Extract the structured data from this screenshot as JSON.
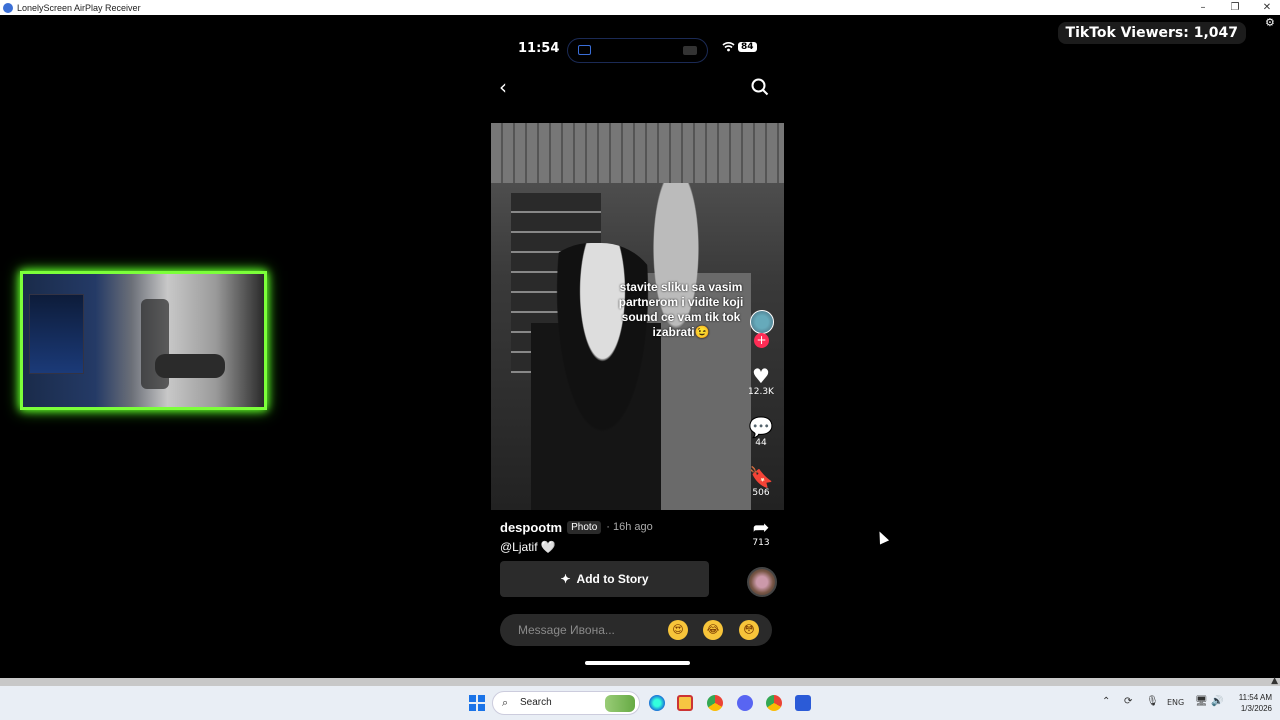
{
  "window": {
    "title": "LonelyScreen AirPlay Receiver",
    "minimize": "–",
    "restore": "❐",
    "close": "✕"
  },
  "overlay": {
    "viewers": "TikTok Viewers: 1,047"
  },
  "phone": {
    "time": "11:54",
    "battery": "84",
    "post": {
      "caption": "stavite sliku sa vasim partnerom i vidite koji sound ce vam tik tok izabrati😉",
      "likes": "12.3K",
      "comments": "44",
      "saves": "506",
      "shares": "713",
      "username": "despootm",
      "type_badge": "Photo",
      "age": "· 16h ago",
      "mention": "@Ljatif 🤍",
      "add_to_story": "Add to Story"
    },
    "message": {
      "placeholder": "Message Ивона...",
      "emojis": [
        "😍",
        "😂",
        "😳"
      ]
    }
  },
  "taskbar": {
    "search_label": "Search",
    "language": "ENG",
    "time": "11:54 AM",
    "date": "1/3/2026"
  }
}
